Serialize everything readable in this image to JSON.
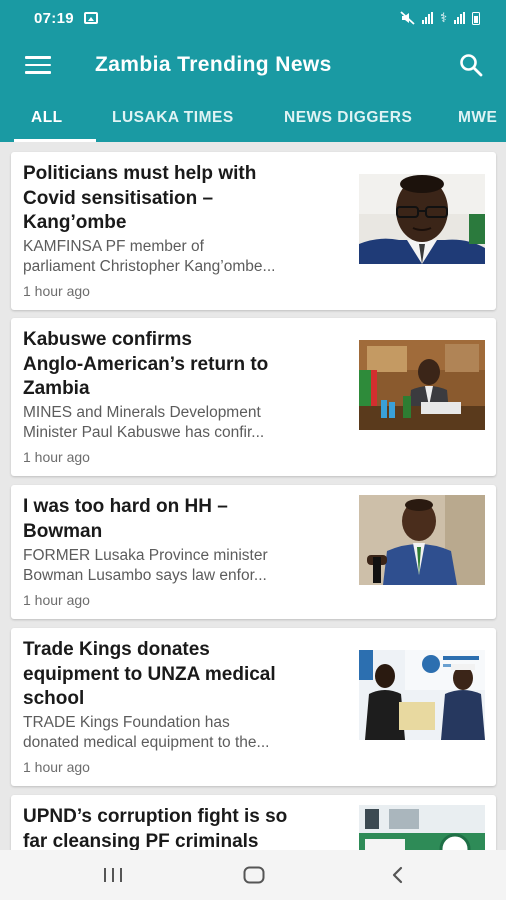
{
  "status_bar": {
    "time": "07:19",
    "icons": [
      "gallery-icon",
      "mute-icon",
      "signal-icon",
      "wifi-calling-icon",
      "signal-icon",
      "battery-icon"
    ]
  },
  "app_bar": {
    "title": "Zambia Trending News",
    "menu_icon": "hamburger-menu-icon",
    "search_icon": "search-icon"
  },
  "tabs": [
    {
      "label": "ALL",
      "active": true
    },
    {
      "label": "LUSAKA TIMES",
      "active": false
    },
    {
      "label": "NEWS DIGGERS",
      "active": false
    },
    {
      "label": "MWE",
      "active": false
    }
  ],
  "articles": [
    {
      "title_lines": [
        "Politicians must help with",
        "Covid sensitisation –",
        "Kang’ombe"
      ],
      "snippet_lines": [
        "KAMFINSA PF member of",
        "parliament Christopher Kang’ombe..."
      ],
      "time": "1 hour ago"
    },
    {
      "title_lines": [
        "Kabuswe confirms",
        "Anglo-American’s return to",
        "Zambia"
      ],
      "snippet_lines": [
        "MINES and Minerals Development",
        "Minister Paul Kabuswe has confir..."
      ],
      "time": "1 hour ago"
    },
    {
      "title_lines": [
        "I was too hard on HH –",
        "Bowman"
      ],
      "snippet_lines": [
        "FORMER Lusaka Province minister",
        "Bowman Lusambo says law enfor..."
      ],
      "time": "1 hour ago"
    },
    {
      "title_lines": [
        "Trade Kings donates",
        "equipment to UNZA medical",
        "school"
      ],
      "snippet_lines": [
        "TRADE Kings Foundation has",
        "donated medical equipment to the..."
      ],
      "time": "1 hour ago"
    },
    {
      "title_lines": [
        "UPND’s corruption fight is so",
        "far cleansing PF criminals"
      ],
      "snippet_lines": [],
      "time": ""
    }
  ],
  "nav_bar": {
    "buttons": [
      "recent-apps-icon",
      "home-icon",
      "back-icon"
    ]
  },
  "colors": {
    "primary": "#1a9aa3",
    "card_background": "#ffffff",
    "feed_background": "#e8e8e8",
    "title_text": "#1a1a1a",
    "snippet_text": "#5c5c5c"
  }
}
